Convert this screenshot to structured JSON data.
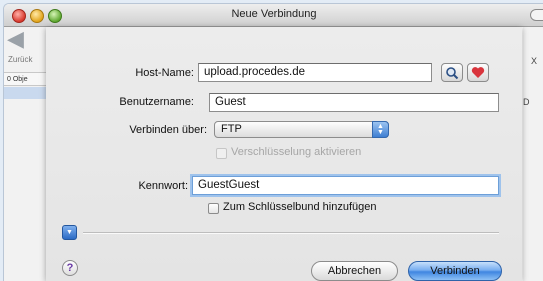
{
  "window": {
    "title": "Neue Verbindung"
  },
  "background": {
    "back_label": "Zurück",
    "column_header": "0 Obje",
    "right_text_1": "X",
    "right_text_2": "D"
  },
  "form": {
    "host_label": "Host-Name:",
    "host_value": "upload.procedes.de",
    "user_label": "Benutzername:",
    "user_value": "Guest",
    "connect_via_label": "Verbinden über:",
    "connect_via_value": "FTP",
    "encryption_label": "Verschlüsselung aktivieren",
    "password_label": "Kennwort:",
    "password_value": "GuestGuest",
    "keychain_label": "Zum Schlüsselbund hinzufügen"
  },
  "buttons": {
    "cancel": "Abbrechen",
    "connect": "Verbinden",
    "help": "?"
  },
  "colors": {
    "accent": "#3f86e1",
    "favorite_heart": "#d9343c"
  }
}
